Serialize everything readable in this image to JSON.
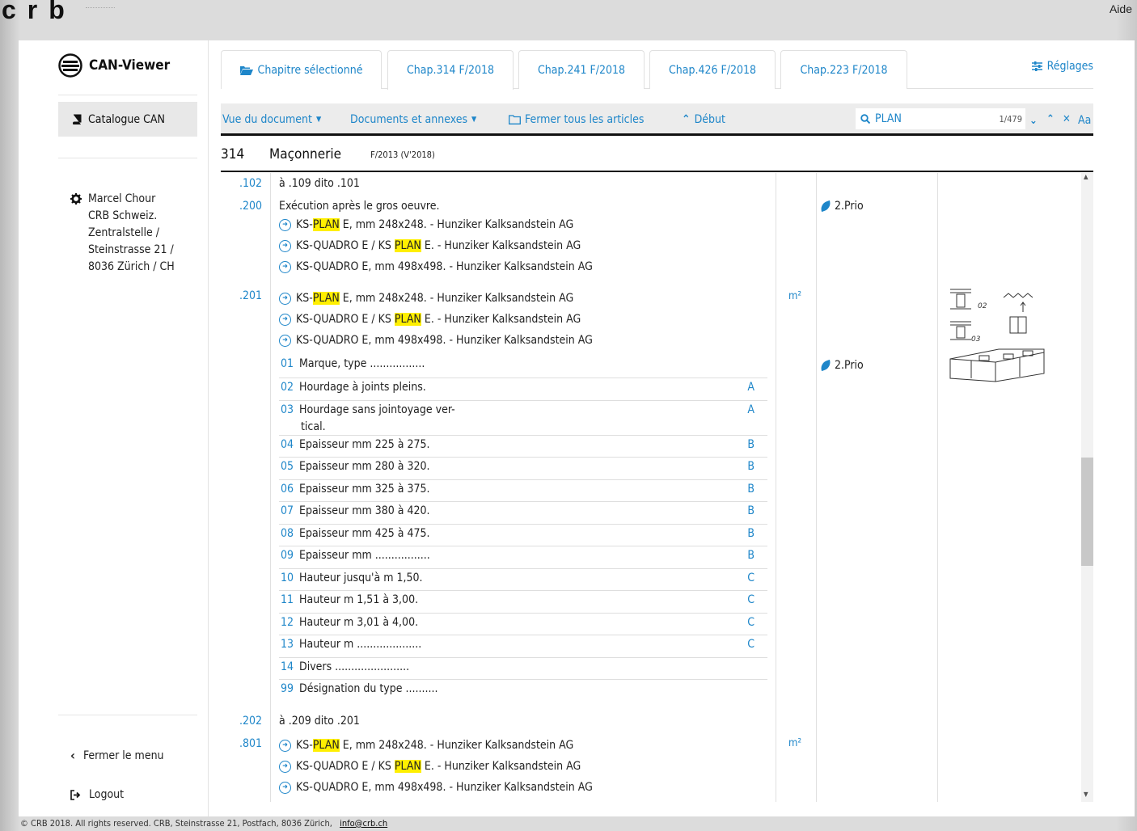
{
  "brand": {
    "logo": "crb",
    "aide": "Aide"
  },
  "sidebar": {
    "app_title": "CAN-Viewer",
    "catalogue": "Catalogue CAN",
    "user": [
      "Marcel Chour",
      "CRB Schweiz.",
      "Zentralstelle /",
      "Steinstrasse 21 /",
      "8036 Zürich / CH"
    ],
    "close_menu": "Fermer le menu",
    "logout": "Logout"
  },
  "tabs": [
    {
      "label": "Chapitre sélectionné",
      "icon": "folder-open-icon"
    },
    {
      "label": "Chap.314 F/2018"
    },
    {
      "label": "Chap.241 F/2018"
    },
    {
      "label": "Chap.426 F/2018"
    },
    {
      "label": "Chap.223 F/2018"
    }
  ],
  "settings_label": "Réglages",
  "toolbar": {
    "doc_view": "Vue du document",
    "docs_annexes": "Documents et annexes",
    "close_all": "Fermer tous les articles",
    "start": "Début",
    "search_value": "PLAN",
    "search_count": "1/479",
    "case_label": "Aa"
  },
  "chapter": {
    "number": "314",
    "title": "Maçonnerie",
    "version": "F/2013 (V'2018)"
  },
  "content": {
    "r102": {
      "code": ".102",
      "text": "à .109 dito .101"
    },
    "r200": {
      "code": ".200",
      "text": "Exécution après le gros oeuvre."
    },
    "products": {
      "p1_a": "KS-",
      "p1_hl": "PLAN",
      "p1_b": " E, mm 248x248. - Hunziker Kalksandstein AG",
      "p2_a": "KS-QUADRO E / KS ",
      "p2_hl": "PLAN",
      "p2_b": " E. - Hunziker Kalksandstein AG",
      "p3": "KS-QUADRO E, mm 498x498. - Hunziker Kalksandstein AG"
    },
    "r201": {
      "code": ".201",
      "unit": "m²"
    },
    "prio": "2.Prio",
    "options": [
      {
        "n": "01",
        "t": "Marque, type .................",
        "c": ""
      },
      {
        "n": "02",
        "t": "Hourdage à joints pleins.",
        "c": "A"
      },
      {
        "n": "03",
        "t": "Hourdage sans jointoyage ver-",
        "t2": "tical.",
        "c": "A"
      },
      {
        "n": "04",
        "t": "Epaisseur mm 225 à 275.",
        "c": "B"
      },
      {
        "n": "05",
        "t": "Epaisseur mm 280 à 320.",
        "c": "B"
      },
      {
        "n": "06",
        "t": "Epaisseur mm 325 à 375.",
        "c": "B"
      },
      {
        "n": "07",
        "t": "Epaisseur mm 380 à 420.",
        "c": "B"
      },
      {
        "n": "08",
        "t": "Epaisseur mm 425 à 475.",
        "c": "B"
      },
      {
        "n": "09",
        "t": "Epaisseur mm .................",
        "c": "B"
      },
      {
        "n": "10",
        "t": "Hauteur jusqu'à m 1,50.",
        "c": "C"
      },
      {
        "n": "11",
        "t": "Hauteur m 1,51 à 3,00.",
        "c": "C"
      },
      {
        "n": "12",
        "t": "Hauteur m 3,01 à 4,00.",
        "c": "C"
      },
      {
        "n": "13",
        "t": "Hauteur m ....................",
        "c": "C"
      },
      {
        "n": "14",
        "t": "Divers .......................",
        "c": ""
      },
      {
        "n": "99",
        "t": "Désignation du type ..........",
        "c": ""
      }
    ],
    "r202": {
      "code": ".202",
      "text": "à .209 dito .201"
    },
    "r801": {
      "code": ".801",
      "unit": "m²"
    },
    "sketch_labels": {
      "a": "02",
      "b": "03"
    }
  },
  "footer": {
    "text": "© CRB 2018. All rights reserved. CRB, Steinstrasse 21, Postfach, 8036 Zürich,",
    "email": "info@crb.ch"
  },
  "colors": {
    "link": "#1e86c9",
    "highlight": "#ffef00",
    "toolbar_bg": "#ececec"
  }
}
